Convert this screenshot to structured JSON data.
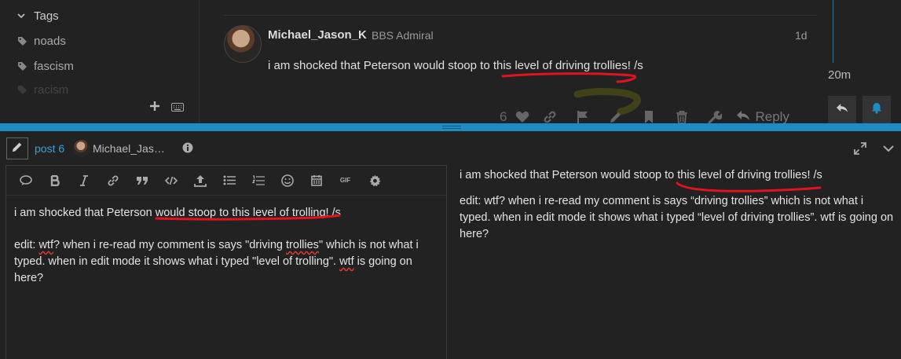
{
  "sidebar": {
    "section_label": "Tags",
    "tags": [
      "noads",
      "fascism",
      "racism"
    ]
  },
  "post": {
    "username": "Michael_Jason_K",
    "user_title": "BBS Admiral",
    "date": "1d",
    "text": "i am shocked that Peterson would stoop to this level of driving trollies! /s",
    "like_count": "6",
    "reply_label": "Reply"
  },
  "timeline": {
    "age": "20m"
  },
  "composer": {
    "post_link": "post 6",
    "reply_to_user": "Michael_Jas…",
    "toolbar_gif": "GIF",
    "editor_line1": "i am shocked that Peterson would stoop to this level of trolling!  /s",
    "editor_edit_prefix": "edit: ",
    "editor_wtf": "wtf",
    "editor_mid1": "? when i re-read my comment is says \"driving ",
    "editor_trollies": "trollies",
    "editor_mid2": "\" which is not what i typed. when in edit mode it shows what i typed \"level of trolling\". ",
    "editor_wtf2": "wtf",
    "editor_end": " is going on here?",
    "preview_line1": "i am shocked that Peterson would stoop to this level of driving trollies! /s",
    "preview_line2": "edit: wtf? when i re-read my comment is says “driving trollies” which is not what i typed. when in edit mode it shows what i typed “level of driving trollies”. wtf is going on here?"
  },
  "colors": {
    "accent": "#1f8bc5",
    "link": "#3aa0d8",
    "annotation": "#e0141e"
  }
}
